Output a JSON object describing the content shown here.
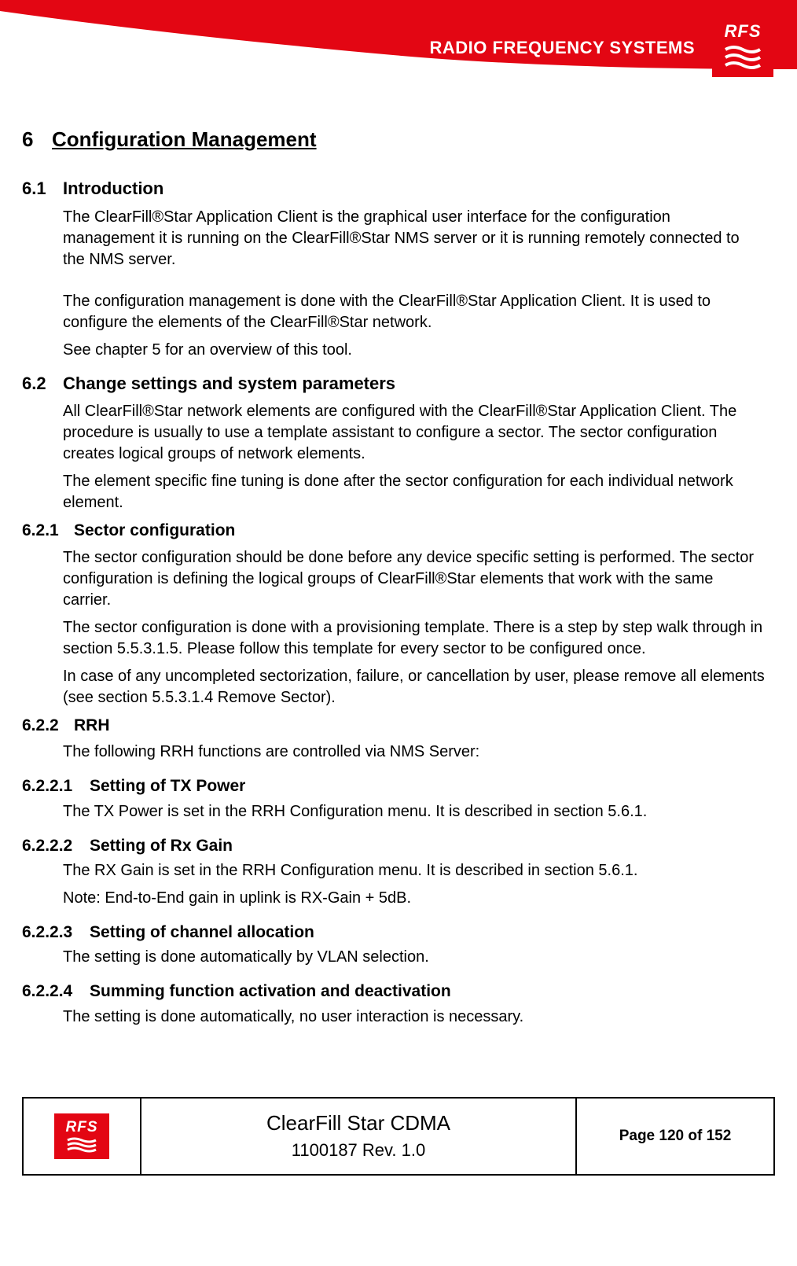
{
  "header": {
    "brand_text": "RADIO FREQUENCY SYSTEMS",
    "logo_text": "RFS"
  },
  "sections": {
    "s6": {
      "num": "6",
      "title": "Configuration Management"
    },
    "s6_1": {
      "num": "6.1",
      "title": "Introduction"
    },
    "p6_1a": "The ClearFill®Star Application Client is the graphical user interface for the configuration management it is running on the ClearFill®Star NMS server or it is running remotely connected to the NMS server.",
    "p6_1b": "The configuration management is done with the ClearFill®Star Application Client. It is used to configure the elements of the ClearFill®Star network.",
    "p6_1c": "See chapter 5 for an overview of this tool.",
    "s6_2": {
      "num": "6.2",
      "title": "Change settings and system parameters"
    },
    "p6_2a": "All ClearFill®Star network elements are configured with the ClearFill®Star Application Client. The procedure is usually to use a template assistant to configure a sector. The sector configuration creates logical groups of network elements.",
    "p6_2b": "The element specific fine tuning is done after the sector configuration for each individual network element.",
    "s6_2_1": {
      "num": "6.2.1",
      "title": "Sector configuration"
    },
    "p6_2_1a": "The sector configuration should be done before any device specific setting is performed. The sector configuration is defining the logical groups of ClearFill®Star elements that work with the same carrier.",
    "p6_2_1b": "The sector configuration is done with a provisioning template. There is a step by step walk through in section 5.5.3.1.5. Please follow this template for every sector to be configured once.",
    "p6_2_1c": "In case of any uncompleted sectorization, failure, or cancellation by user, please remove all elements (see section 5.5.3.1.4 Remove Sector).",
    "s6_2_2": {
      "num": "6.2.2",
      "title": "RRH"
    },
    "p6_2_2": "The following RRH functions are controlled via NMS Server:",
    "s6_2_2_1": {
      "num": "6.2.2.1",
      "title": "Setting of TX Power"
    },
    "p6_2_2_1": "The TX Power is set in the RRH Configuration menu. It is described in section 5.6.1.",
    "s6_2_2_2": {
      "num": "6.2.2.2",
      "title": "Setting of Rx Gain"
    },
    "p6_2_2_2a": "The RX Gain is set in the RRH Configuration menu. It is described in section 5.6.1.",
    "p6_2_2_2b": "Note: End-to-End gain in uplink is RX-Gain + 5dB.",
    "s6_2_2_3": {
      "num": "6.2.2.3",
      "title": "Setting of channel allocation"
    },
    "p6_2_2_3": "The setting is done automatically by VLAN selection.",
    "s6_2_2_4": {
      "num": "6.2.2.4",
      "title": "Summing function activation and deactivation"
    },
    "p6_2_2_4": "The setting is done automatically, no user interaction is necessary."
  },
  "footer": {
    "logo_text": "RFS",
    "title": "ClearFill Star CDMA",
    "rev": "1100187 Rev. 1.0",
    "page": "Page 120 of 152"
  }
}
